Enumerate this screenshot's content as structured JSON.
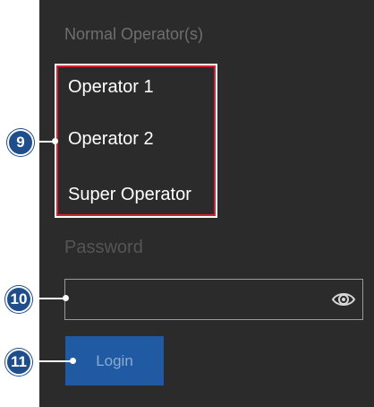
{
  "login_panel": {
    "group_label": "Normal Operator(s)",
    "operators": [
      "Operator 1",
      "Operator 2",
      "Super Operator"
    ],
    "password_label": "Password",
    "password_value": "",
    "eye_icon": "eye-icon",
    "login_label": "Login"
  },
  "callouts": {
    "c9": "9",
    "c10": "10",
    "c11": "11"
  },
  "colors": {
    "panel_bg": "#2b2b2b",
    "highlight_border": "#d4202f",
    "login_button": "#1f5aa3",
    "callout_fill": "#1f4e8c"
  }
}
